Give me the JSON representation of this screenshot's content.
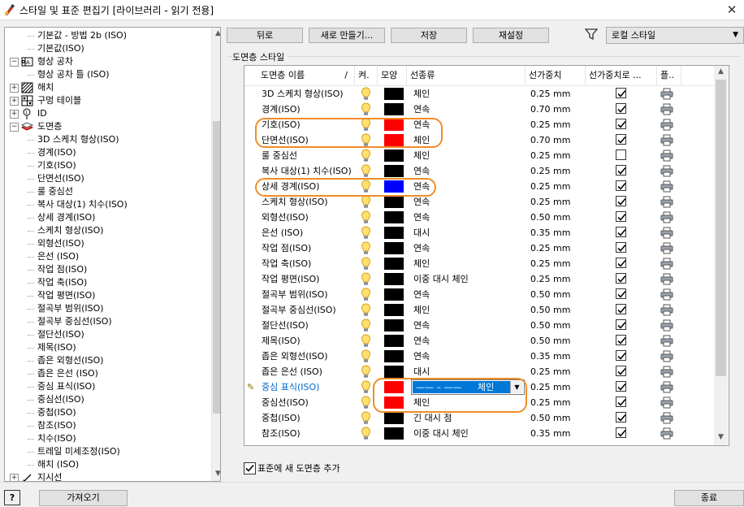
{
  "window": {
    "title": "스타일 및 표준 편집기 [라이브러리 - 읽기 전용]",
    "close_glyph": "✕"
  },
  "tree": {
    "items": [
      {
        "label": "기본값 - 방법 2b (ISO)",
        "level": 2
      },
      {
        "label": "기본값(ISO)",
        "level": 2
      },
      {
        "label": "형상 공차",
        "level": 1,
        "icon": "feature-control-icon",
        "expander": "−"
      },
      {
        "label": "형상 공차 틀 (ISO)",
        "level": 2
      },
      {
        "label": "해치",
        "level": 1,
        "icon": "hatch-icon",
        "expander": "+"
      },
      {
        "label": "구멍 테이블",
        "level": 1,
        "icon": "hole-table-icon",
        "expander": "+"
      },
      {
        "label": "ID",
        "level": 1,
        "icon": "id-icon",
        "expander": "+"
      },
      {
        "label": "도면층",
        "level": 1,
        "icon": "layers-icon",
        "expander": "−"
      },
      {
        "label": "3D 스케치 형상(ISO)",
        "level": 2
      },
      {
        "label": "경계(ISO)",
        "level": 2
      },
      {
        "label": "기호(ISO)",
        "level": 2
      },
      {
        "label": "단면선(ISO)",
        "level": 2
      },
      {
        "label": "룰 중심선",
        "level": 2
      },
      {
        "label": "복사 대상(1) 치수(ISO)",
        "level": 2
      },
      {
        "label": "상세 경계(ISO)",
        "level": 2
      },
      {
        "label": "스케치 형상(ISO)",
        "level": 2
      },
      {
        "label": "외형선(ISO)",
        "level": 2
      },
      {
        "label": "은선 (ISO)",
        "level": 2
      },
      {
        "label": "작업 점(ISO)",
        "level": 2
      },
      {
        "label": "작업 축(ISO)",
        "level": 2
      },
      {
        "label": "작업 평면(ISO)",
        "level": 2
      },
      {
        "label": "절곡부 범위(ISO)",
        "level": 2
      },
      {
        "label": "절곡부 중심선(ISO)",
        "level": 2
      },
      {
        "label": "절단선(ISO)",
        "level": 2
      },
      {
        "label": "제목(ISO)",
        "level": 2
      },
      {
        "label": "좁은 외형선(ISO)",
        "level": 2
      },
      {
        "label": "좁은 은선 (ISO)",
        "level": 2
      },
      {
        "label": "중심 표식(ISO)",
        "level": 2
      },
      {
        "label": "중심선(ISO)",
        "level": 2
      },
      {
        "label": "중첩(ISO)",
        "level": 2
      },
      {
        "label": "참조(ISO)",
        "level": 2
      },
      {
        "label": "치수(ISO)",
        "level": 2
      },
      {
        "label": "트레일 미세조정(ISO)",
        "level": 2
      },
      {
        "label": "해치 (ISO)",
        "level": 2
      },
      {
        "label": "지시선",
        "level": 1,
        "icon": "leader-icon",
        "expander": "+"
      }
    ]
  },
  "toolbar": {
    "back": "뒤로",
    "new": "새로 만들기...",
    "save": "저장",
    "reset": "재설정",
    "filter_value": "로컬 스타일"
  },
  "layers": {
    "section_title": "도면층 스타일",
    "columns": {
      "name": "도면층 이름",
      "on": "켜.",
      "color": "모양",
      "linetype": "선종류",
      "weight": "선가중치",
      "scale": "선가중치로 ...",
      "plot": "플.."
    },
    "rows": [
      {
        "name": "3D 스케치 형상(ISO)",
        "color": "#000000",
        "linetype": "체인",
        "weight": "0.25 mm",
        "checked": true
      },
      {
        "name": "경계(ISO)",
        "color": "#000000",
        "linetype": "연속",
        "weight": "0.70 mm",
        "checked": true
      },
      {
        "name": "기호(ISO)",
        "color": "#ff0000",
        "linetype": "연속",
        "weight": "0.25 mm",
        "checked": true
      },
      {
        "name": "단면선(ISO)",
        "color": "#ff0000",
        "linetype": "체인",
        "weight": "0.70 mm",
        "checked": true
      },
      {
        "name": "룰 중심선",
        "color": "#000000",
        "linetype": "체인",
        "weight": "0.25 mm",
        "checked": false
      },
      {
        "name": "복사 대상(1) 치수(ISO)",
        "color": "#000000",
        "linetype": "연속",
        "weight": "0.25 mm",
        "checked": true
      },
      {
        "name": "상세 경계(ISO)",
        "color": "#0000ff",
        "linetype": "연속",
        "weight": "0.25 mm",
        "checked": true
      },
      {
        "name": "스케치 형상(ISO)",
        "color": "#000000",
        "linetype": "연속",
        "weight": "0.25 mm",
        "checked": true
      },
      {
        "name": "외형선(ISO)",
        "color": "#000000",
        "linetype": "연속",
        "weight": "0.50 mm",
        "checked": true
      },
      {
        "name": "은선 (ISO)",
        "color": "#000000",
        "linetype": "대시",
        "weight": "0.35 mm",
        "checked": true
      },
      {
        "name": "작업 점(ISO)",
        "color": "#000000",
        "linetype": "연속",
        "weight": "0.25 mm",
        "checked": true
      },
      {
        "name": "작업 축(ISO)",
        "color": "#000000",
        "linetype": "체인",
        "weight": "0.25 mm",
        "checked": true
      },
      {
        "name": "작업 평면(ISO)",
        "color": "#000000",
        "linetype": "이중 대시 체인",
        "weight": "0.25 mm",
        "checked": true
      },
      {
        "name": "절곡부 범위(ISO)",
        "color": "#000000",
        "linetype": "연속",
        "weight": "0.50 mm",
        "checked": true
      },
      {
        "name": "절곡부 중심선(ISO)",
        "color": "#000000",
        "linetype": "체인",
        "weight": "0.50 mm",
        "checked": true
      },
      {
        "name": "절단선(ISO)",
        "color": "#000000",
        "linetype": "연속",
        "weight": "0.50 mm",
        "checked": true
      },
      {
        "name": "제목(ISO)",
        "color": "#000000",
        "linetype": "연속",
        "weight": "0.50 mm",
        "checked": true
      },
      {
        "name": "좁은 외형선(ISO)",
        "color": "#000000",
        "linetype": "연속",
        "weight": "0.35 mm",
        "checked": true
      },
      {
        "name": "좁은 은선 (ISO)",
        "color": "#000000",
        "linetype": "대시",
        "weight": "0.25 mm",
        "checked": true
      },
      {
        "name": "중심 표식(ISO)",
        "color": "#ff0000",
        "linetype": "체인",
        "weight": "0.25 mm",
        "checked": true,
        "editing": true
      },
      {
        "name": "중심선(ISO)",
        "color": "#ff0000",
        "linetype": "체인",
        "weight": "0.25 mm",
        "checked": true
      },
      {
        "name": "중첩(ISO)",
        "color": "#000000",
        "linetype": "긴 대시 점",
        "weight": "0.50 mm",
        "checked": true
      },
      {
        "name": "참조(ISO)",
        "color": "#000000",
        "linetype": "이중 대시 체인",
        "weight": "0.35 mm",
        "checked": true
      }
    ],
    "editor": {
      "sample": "—— – ——",
      "value": "체인"
    }
  },
  "footer": {
    "add_to_standard": "표준에 새 도면층 추가",
    "import": "가져오기",
    "close": "종료",
    "help": "?"
  },
  "colors": {
    "highlight": "#f08c28",
    "selection": "#0078d7",
    "edit_text": "#0066cc"
  }
}
